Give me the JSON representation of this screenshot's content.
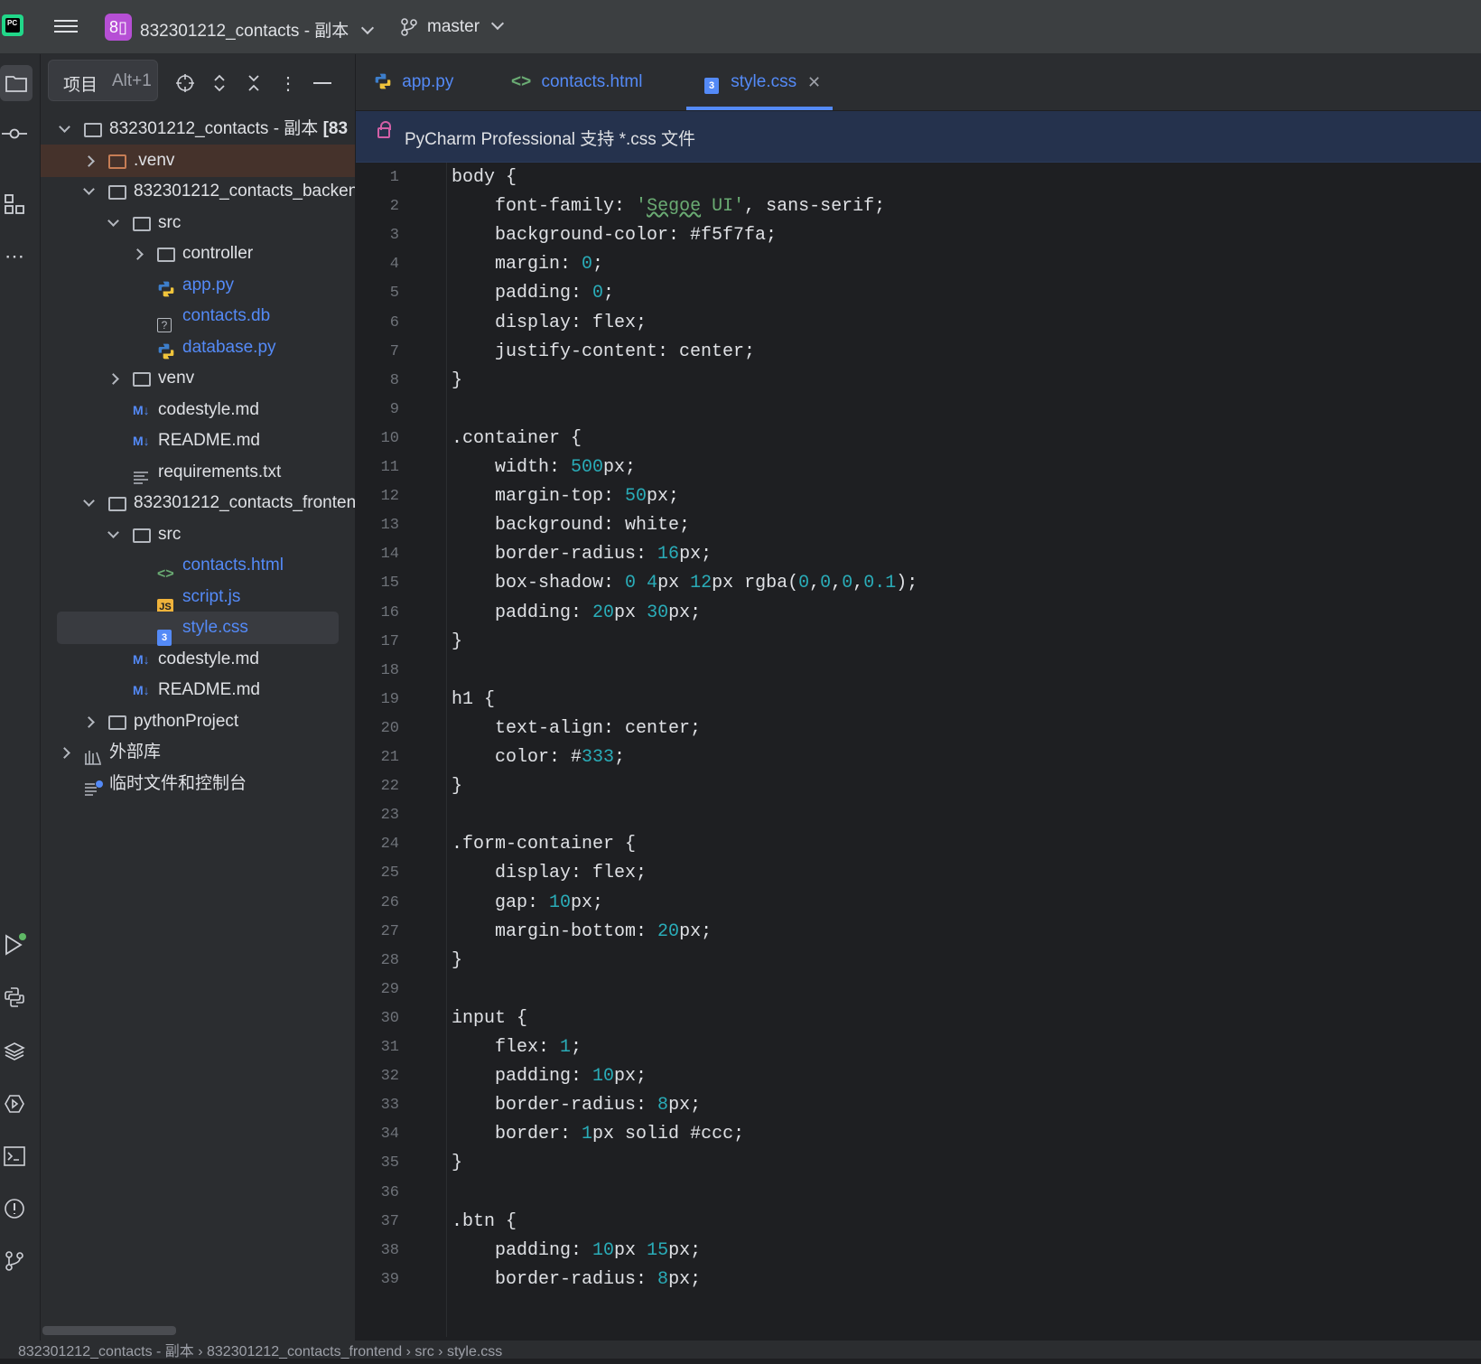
{
  "titlebar": {
    "project_badge": "8▯",
    "project_name": "832301212_contacts - 副本",
    "branch": "master"
  },
  "project_panel": {
    "tab_label": "项目",
    "tab_shortcut": "Alt+1",
    "tree": [
      {
        "label": "832301212_contacts - 副本 [83",
        "type": "folder",
        "expanded": true
      },
      {
        "label": ".venv",
        "type": "folder-orange",
        "expanded": false
      },
      {
        "label": "832301212_contacts_backen",
        "type": "folder",
        "expanded": true
      },
      {
        "label": "src",
        "type": "folder",
        "expanded": true
      },
      {
        "label": "controller",
        "type": "folder",
        "expanded": false
      },
      {
        "label": "app.py",
        "type": "python"
      },
      {
        "label": "contacts.db",
        "type": "unknown"
      },
      {
        "label": "database.py",
        "type": "python"
      },
      {
        "label": "venv",
        "type": "folder",
        "expanded": false
      },
      {
        "label": "codestyle.md",
        "type": "md"
      },
      {
        "label": "README.md",
        "type": "md"
      },
      {
        "label": "requirements.txt",
        "type": "text"
      },
      {
        "label": "832301212_contacts_fronten",
        "type": "folder",
        "expanded": true
      },
      {
        "label": "src",
        "type": "folder",
        "expanded": true
      },
      {
        "label": "contacts.html",
        "type": "html"
      },
      {
        "label": "script.js",
        "type": "js"
      },
      {
        "label": "style.css",
        "type": "css"
      },
      {
        "label": "codestyle.md",
        "type": "md"
      },
      {
        "label": "README.md",
        "type": "md"
      },
      {
        "label": "pythonProject",
        "type": "folder",
        "expanded": false
      },
      {
        "label": "外部库",
        "type": "library",
        "expanded": false
      },
      {
        "label": "临时文件和控制台",
        "type": "scratch"
      }
    ]
  },
  "editor": {
    "tabs": [
      {
        "label": "app.py",
        "icon": "python-icon"
      },
      {
        "label": "contacts.html",
        "icon": "html-icon"
      },
      {
        "label": "style.css",
        "icon": "css-icon",
        "active": true
      }
    ],
    "banner": "PyCharm Professional 支持 *.css 文件",
    "lines": [
      "body {",
      "    font-family: 'Segoe UI', sans-serif;",
      "    background-color: #f5f7fa;",
      "    margin: 0;",
      "    padding: 0;",
      "    display: flex;",
      "    justify-content: center;",
      "}",
      "",
      ".container {",
      "    width: 500px;",
      "    margin-top: 50px;",
      "    background: white;",
      "    border-radius: 16px;",
      "    box-shadow: 0 4px 12px rgba(0,0,0,0.1);",
      "    padding: 20px 30px;",
      "}",
      "",
      "h1 {",
      "    text-align: center;",
      "    color: #333;",
      "}",
      "",
      ".form-container {",
      "    display: flex;",
      "    gap: 10px;",
      "    margin-bottom: 20px;",
      "}",
      "",
      "input {",
      "    flex: 1;",
      "    padding: 10px;",
      "    border-radius: 8px;",
      "    border: 1px solid #ccc;",
      "}",
      "",
      ".btn {",
      "    padding: 10px 15px;",
      "    border-radius: 8px;"
    ]
  },
  "statusbar": {
    "breadcrumb": "832301212_contacts - 副本 › 832301212_contacts_frontend › src › style.css"
  },
  "colors": {
    "accent": "#548af7",
    "number": "#2aacb8",
    "string": "#6aab73",
    "venv_highlight": "#45322b",
    "banner_bg": "#25324d"
  }
}
